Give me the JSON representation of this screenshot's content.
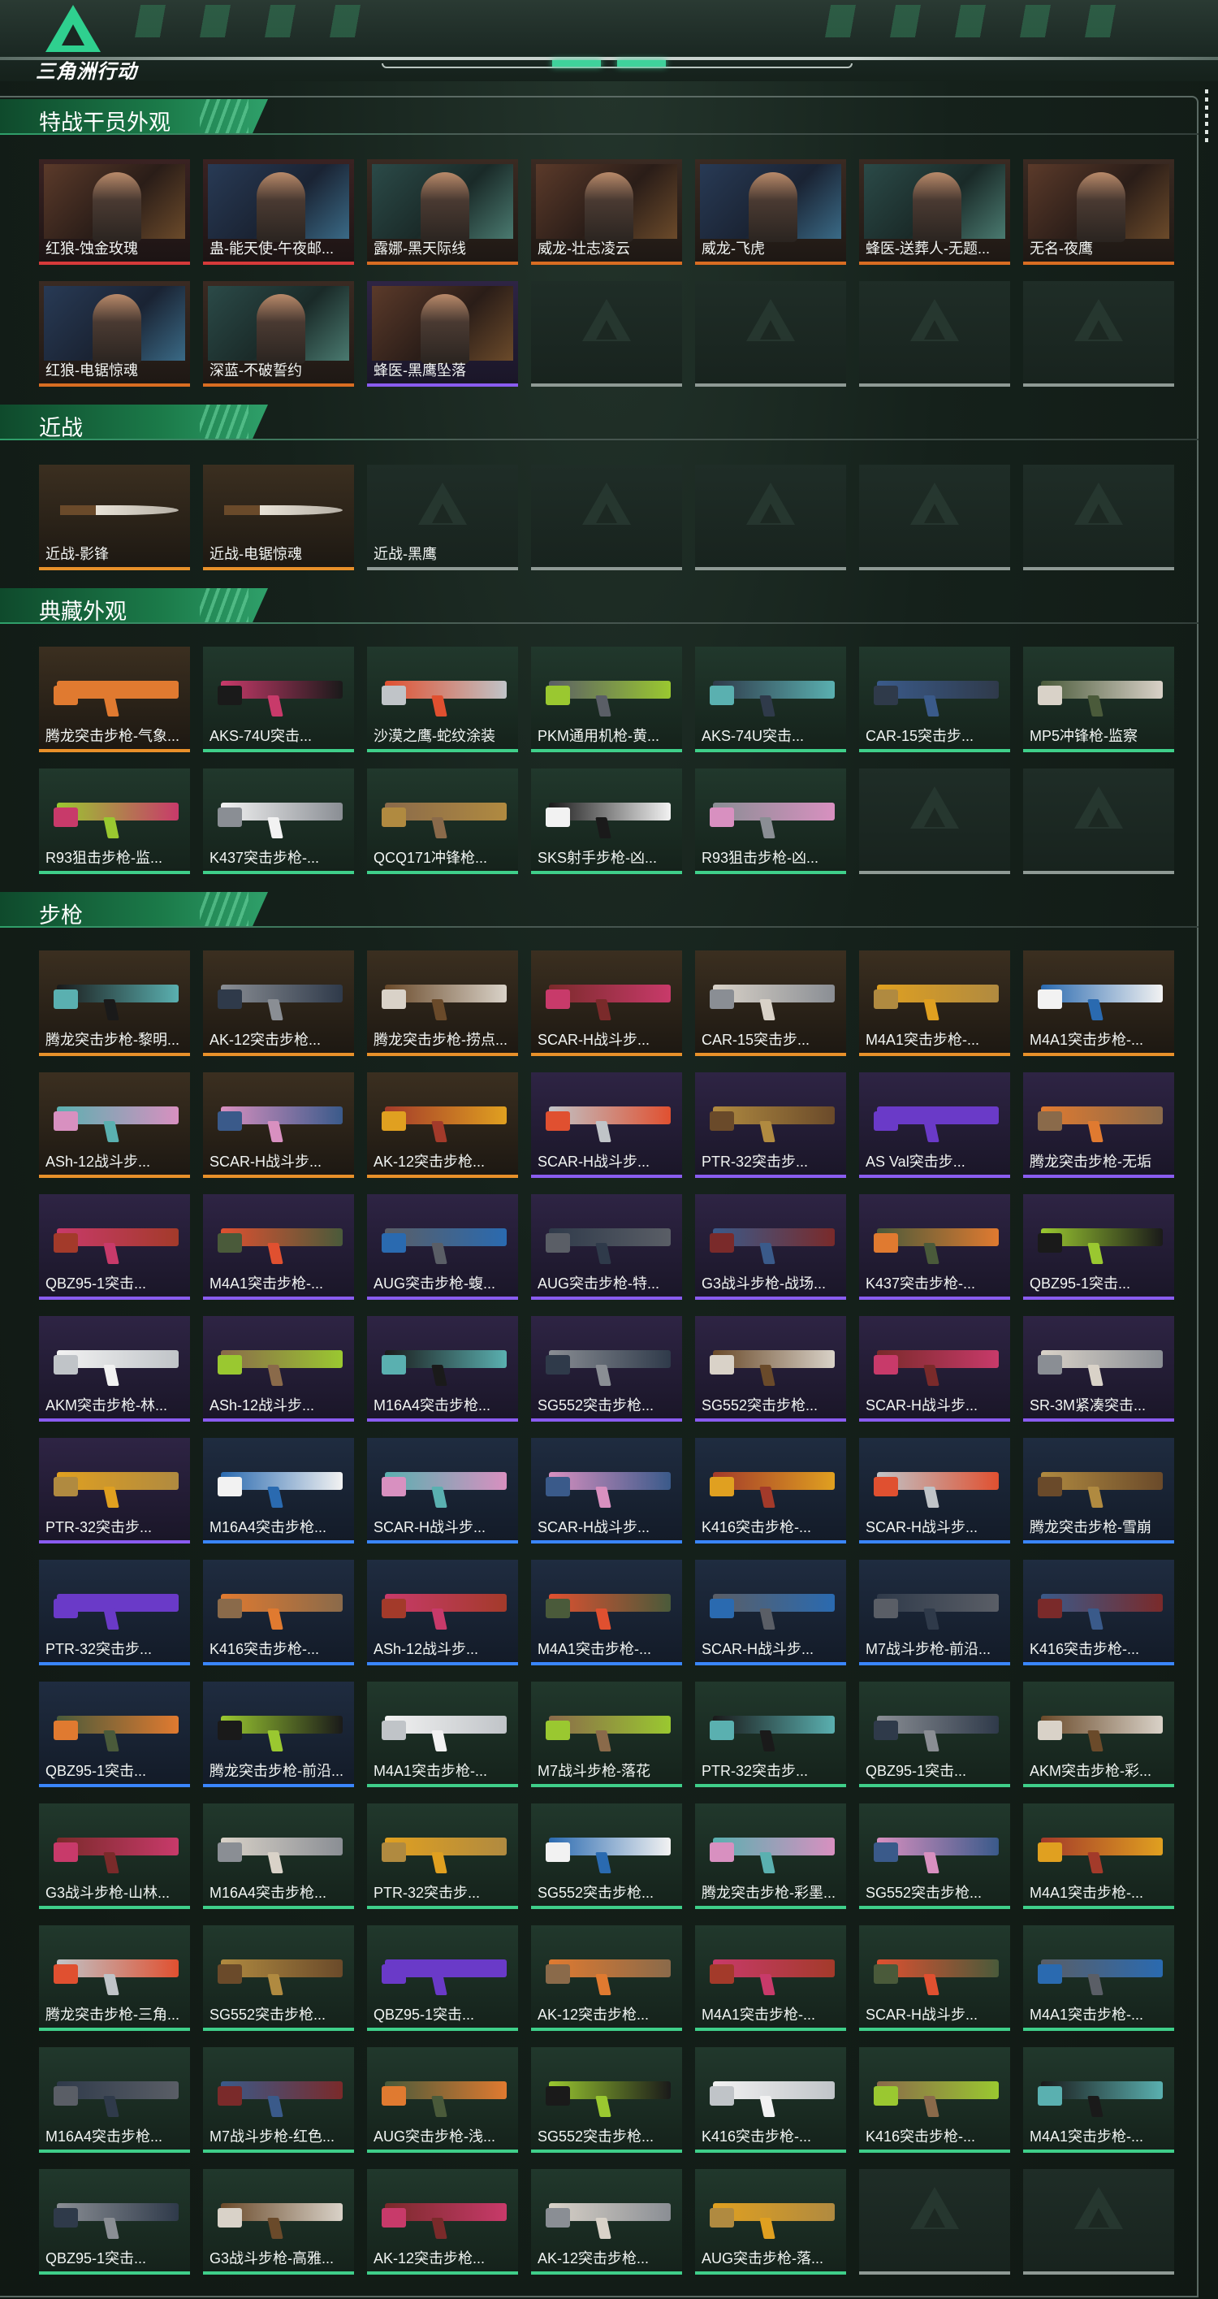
{
  "app": {
    "logo_text": "三角洲行动"
  },
  "sections": [
    {
      "id": "operators",
      "title": "特战干员外观",
      "kind": "operator",
      "items": [
        {
          "label": "红狼-蚀金玫瑰",
          "rarity": "red"
        },
        {
          "label": "蛊-能天使-午夜邮...",
          "rarity": "red"
        },
        {
          "label": "露娜-黑天际线",
          "rarity": "orange"
        },
        {
          "label": "威龙-壮志凌云",
          "rarity": "orange"
        },
        {
          "label": "威龙-飞虎",
          "rarity": "orange"
        },
        {
          "label": "蜂医-送葬人-无题...",
          "rarity": "orange"
        },
        {
          "label": "无名-夜鹰",
          "rarity": "orange"
        },
        {
          "label": "红狼-电锯惊魂",
          "rarity": "orange"
        },
        {
          "label": "深蓝-不破誓约",
          "rarity": "orange"
        },
        {
          "label": "蜂医-黑鹰坠落",
          "rarity": "purple"
        },
        {
          "label": "",
          "rarity": "empty"
        },
        {
          "label": "",
          "rarity": "empty"
        },
        {
          "label": "",
          "rarity": "empty"
        },
        {
          "label": "",
          "rarity": "empty"
        }
      ]
    },
    {
      "id": "melee",
      "title": "近战",
      "kind": "melee",
      "items": [
        {
          "label": "近战-影锋",
          "rarity": "gold"
        },
        {
          "label": "近战-电锯惊魂",
          "rarity": "gold"
        },
        {
          "label": "近战-黑鹰",
          "rarity": "empty"
        },
        {
          "label": "",
          "rarity": "empty"
        },
        {
          "label": "",
          "rarity": "empty"
        },
        {
          "label": "",
          "rarity": "empty"
        },
        {
          "label": "",
          "rarity": "empty"
        }
      ]
    },
    {
      "id": "collection",
      "title": "典藏外观",
      "kind": "gun",
      "items": [
        {
          "label": "腾龙突击步枪-气象...",
          "rarity": "gold"
        },
        {
          "label": "AKS-74U突击...",
          "rarity": "green"
        },
        {
          "label": "沙漠之鹰-蛇纹涂装",
          "rarity": "green"
        },
        {
          "label": "PKM通用机枪-黄...",
          "rarity": "green"
        },
        {
          "label": "AKS-74U突击...",
          "rarity": "green"
        },
        {
          "label": "CAR-15突击步...",
          "rarity": "green"
        },
        {
          "label": "MP5冲锋枪-监察",
          "rarity": "green"
        },
        {
          "label": "R93狙击步枪-监...",
          "rarity": "green"
        },
        {
          "label": "K437突击步枪-...",
          "rarity": "green"
        },
        {
          "label": "QCQ171冲锋枪...",
          "rarity": "green"
        },
        {
          "label": "SKS射手步枪-凶...",
          "rarity": "green"
        },
        {
          "label": "R93狙击步枪-凶...",
          "rarity": "green"
        },
        {
          "label": "",
          "rarity": "empty"
        },
        {
          "label": "",
          "rarity": "empty"
        }
      ]
    },
    {
      "id": "rifles",
      "title": "步枪",
      "kind": "gun",
      "items": [
        {
          "label": "腾龙突击步枪-黎明...",
          "rarity": "gold"
        },
        {
          "label": "AK-12突击步枪...",
          "rarity": "gold"
        },
        {
          "label": "腾龙突击步枪-捞点...",
          "rarity": "gold"
        },
        {
          "label": "SCAR-H战斗步...",
          "rarity": "gold"
        },
        {
          "label": "CAR-15突击步...",
          "rarity": "gold"
        },
        {
          "label": "M4A1突击步枪-...",
          "rarity": "gold"
        },
        {
          "label": "M4A1突击步枪-...",
          "rarity": "gold"
        },
        {
          "label": "ASh-12战斗步...",
          "rarity": "gold"
        },
        {
          "label": "SCAR-H战斗步...",
          "rarity": "gold"
        },
        {
          "label": "AK-12突击步枪...",
          "rarity": "gold"
        },
        {
          "label": "SCAR-H战斗步...",
          "rarity": "purple"
        },
        {
          "label": "PTR-32突击步...",
          "rarity": "purple"
        },
        {
          "label": "AS Val突击步...",
          "rarity": "purple"
        },
        {
          "label": "腾龙突击步枪-无垢",
          "rarity": "purple"
        },
        {
          "label": "QBZ95-1突击...",
          "rarity": "purple"
        },
        {
          "label": "M4A1突击步枪-...",
          "rarity": "purple"
        },
        {
          "label": "AUG突击步枪-蝮...",
          "rarity": "purple"
        },
        {
          "label": "AUG突击步枪-特...",
          "rarity": "purple"
        },
        {
          "label": "G3战斗步枪-战场...",
          "rarity": "purple"
        },
        {
          "label": "K437突击步枪-...",
          "rarity": "purple"
        },
        {
          "label": "QBZ95-1突击...",
          "rarity": "purple"
        },
        {
          "label": "AKM突击步枪-林...",
          "rarity": "purple"
        },
        {
          "label": "ASh-12战斗步...",
          "rarity": "purple"
        },
        {
          "label": "M16A4突击步枪...",
          "rarity": "purple"
        },
        {
          "label": "SG552突击步枪...",
          "rarity": "purple"
        },
        {
          "label": "SG552突击步枪...",
          "rarity": "purple"
        },
        {
          "label": "SCAR-H战斗步...",
          "rarity": "purple"
        },
        {
          "label": "SR-3M紧凑突击...",
          "rarity": "purple"
        },
        {
          "label": "PTR-32突击步...",
          "rarity": "purple"
        },
        {
          "label": "M16A4突击步枪...",
          "rarity": "blue"
        },
        {
          "label": "SCAR-H战斗步...",
          "rarity": "blue"
        },
        {
          "label": "SCAR-H战斗步...",
          "rarity": "blue"
        },
        {
          "label": "K416突击步枪-...",
          "rarity": "blue"
        },
        {
          "label": "SCAR-H战斗步...",
          "rarity": "blue"
        },
        {
          "label": "腾龙突击步枪-雪崩",
          "rarity": "blue"
        },
        {
          "label": "PTR-32突击步...",
          "rarity": "blue"
        },
        {
          "label": "K416突击步枪-...",
          "rarity": "blue"
        },
        {
          "label": "ASh-12战斗步...",
          "rarity": "blue"
        },
        {
          "label": "M4A1突击步枪-...",
          "rarity": "blue"
        },
        {
          "label": "SCAR-H战斗步...",
          "rarity": "blue"
        },
        {
          "label": "M7战斗步枪-前沿...",
          "rarity": "blue"
        },
        {
          "label": "K416突击步枪-...",
          "rarity": "blue"
        },
        {
          "label": "QBZ95-1突击...",
          "rarity": "blue"
        },
        {
          "label": "腾龙突击步枪-前沿...",
          "rarity": "blue"
        },
        {
          "label": "M4A1突击步枪-...",
          "rarity": "green"
        },
        {
          "label": "M7战斗步枪-落花",
          "rarity": "green"
        },
        {
          "label": "PTR-32突击步...",
          "rarity": "green"
        },
        {
          "label": "QBZ95-1突击...",
          "rarity": "green"
        },
        {
          "label": "AKM突击步枪-彩...",
          "rarity": "green"
        },
        {
          "label": "G3战斗步枪-山林...",
          "rarity": "green"
        },
        {
          "label": "M16A4突击步枪...",
          "rarity": "green"
        },
        {
          "label": "PTR-32突击步...",
          "rarity": "green"
        },
        {
          "label": "SG552突击步枪...",
          "rarity": "green"
        },
        {
          "label": "腾龙突击步枪-彩墨...",
          "rarity": "green"
        },
        {
          "label": "SG552突击步枪...",
          "rarity": "green"
        },
        {
          "label": "M4A1突击步枪-...",
          "rarity": "green"
        },
        {
          "label": "腾龙突击步枪-三角...",
          "rarity": "green"
        },
        {
          "label": "SG552突击步枪...",
          "rarity": "green"
        },
        {
          "label": "QBZ95-1突击...",
          "rarity": "green"
        },
        {
          "label": "AK-12突击步枪...",
          "rarity": "green"
        },
        {
          "label": "M4A1突击步枪-...",
          "rarity": "green"
        },
        {
          "label": "SCAR-H战斗步...",
          "rarity": "green"
        },
        {
          "label": "M4A1突击步枪-...",
          "rarity": "green"
        },
        {
          "label": "M16A4突击步枪...",
          "rarity": "green"
        },
        {
          "label": "M7战斗步枪-红色...",
          "rarity": "green"
        },
        {
          "label": "AUG突击步枪-浅...",
          "rarity": "green"
        },
        {
          "label": "SG552突击步枪...",
          "rarity": "green"
        },
        {
          "label": "K416突击步枪-...",
          "rarity": "green"
        },
        {
          "label": "K416突击步枪-...",
          "rarity": "green"
        },
        {
          "label": "M4A1突击步枪-...",
          "rarity": "green"
        },
        {
          "label": "QBZ95-1突击...",
          "rarity": "green"
        },
        {
          "label": "G3战斗步枪-高雅...",
          "rarity": "green"
        },
        {
          "label": "AK-12突击步枪...",
          "rarity": "green"
        },
        {
          "label": "AK-12突击步枪...",
          "rarity": "green"
        },
        {
          "label": "AUG突击步枪-落...",
          "rarity": "green"
        },
        {
          "label": "",
          "rarity": "empty"
        },
        {
          "label": "",
          "rarity": "empty"
        }
      ]
    }
  ],
  "gun_colors": [
    "#5a5e66",
    "#8a8e94",
    "#a33a2a",
    "#2f3a4a",
    "#6a4a2a",
    "#c0c4c8",
    "#3a5a8a",
    "#7a2a2a",
    "#b08a40",
    "#4a5a3a",
    "#d9d2c8",
    "#6a3ac8",
    "#9ac830",
    "#e0a020",
    "#e07a30",
    "#f2f2f2",
    "#2a6ab0",
    "#c83a6a",
    "#8a6a4a",
    "#5ab0b0",
    "#e05030",
    "#1a1a1a",
    "#d890c0"
  ]
}
